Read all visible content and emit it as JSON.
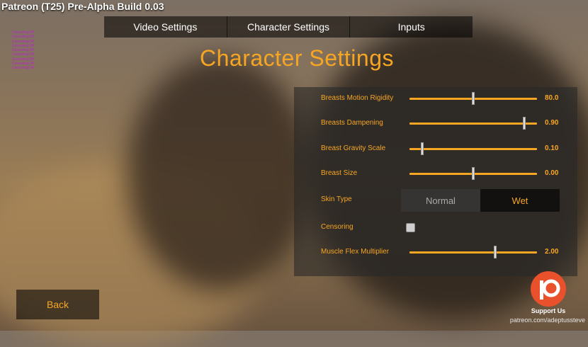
{
  "build_title": "Patreon (T25) Pre-Alpha Build 0.03",
  "debug_lines": [
    "Censoring:Off",
    "Censoring:Off",
    "Censoring:Off",
    "Censoring:Off",
    "Censoring:Off",
    "Censoring:Off",
    "Censoring:Off",
    "Censoring:Off",
    "Censoring:Off"
  ],
  "tabs": [
    {
      "label": "Video Settings"
    },
    {
      "label": "Character Settings"
    },
    {
      "label": "Inputs"
    }
  ],
  "page_title": "Character Settings",
  "settings": {
    "breasts_motion_rigidity": {
      "label": "Breasts Motion Rigidity",
      "value": "80.0",
      "slider_fraction": 0.5
    },
    "breasts_dampening": {
      "label": "Breasts Dampening",
      "value": "0.90",
      "slider_fraction": 0.9
    },
    "breast_gravity_scale": {
      "label": "Breast Gravity Scale",
      "value": "0.10",
      "slider_fraction": 0.1
    },
    "breast_size": {
      "label": "Breast Size",
      "value": "0.00",
      "slider_fraction": 0.5
    },
    "skin_type": {
      "label": "Skin Type",
      "options": [
        "Normal",
        "Wet"
      ],
      "selected": "Wet"
    },
    "censoring": {
      "label": "Censoring",
      "checked": false
    },
    "muscle_flex_multiplier": {
      "label": "Muscle Flex Multiplier",
      "value": "2.00",
      "slider_fraction": 0.67
    }
  },
  "back_label": "Back",
  "support": {
    "label": "Support Us",
    "url": "patreon.com/adeptussteve"
  },
  "colors": {
    "accent": "#f7a623",
    "debug_text": "#c01fd0",
    "patreon": "#e8512b"
  }
}
